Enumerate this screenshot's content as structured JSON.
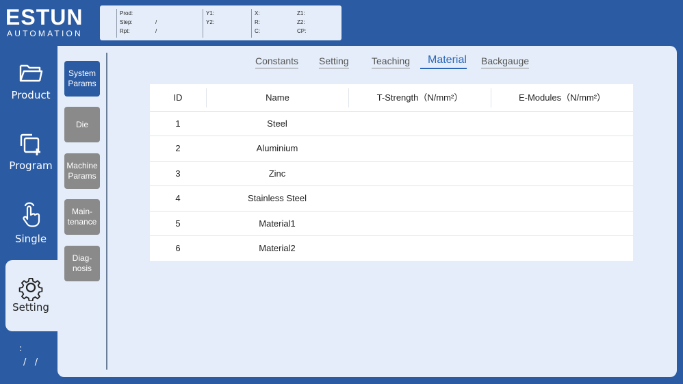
{
  "logo": {
    "brand": "ESTUN",
    "tagline": "AUTOMATION"
  },
  "status": {
    "prod_label": "Prod:",
    "prod_value": "",
    "step_label": "Step:",
    "step_value": "/",
    "rpt_label": "Rpt:",
    "rpt_value": "/",
    "y1_label": "Y1:",
    "y2_label": "Y2:",
    "x_label": "X:",
    "r_label": "R:",
    "c_label": "C:",
    "z1_label": "Z1:",
    "z2_label": "Z2:",
    "cp_label": "CP:"
  },
  "nav": {
    "items": [
      {
        "label": "Product",
        "icon": "folder-icon"
      },
      {
        "label": "Program",
        "icon": "copy-plus-icon"
      },
      {
        "label": "Single",
        "icon": "hand-pointer-icon"
      },
      {
        "label": "Setting",
        "icon": "gear-icon"
      }
    ],
    "footer_line1": ":",
    "footer_line2": "/   /"
  },
  "subnav": {
    "items": [
      {
        "label_1": "System",
        "label_2": "Params"
      },
      {
        "label_1": "Die",
        "label_2": ""
      },
      {
        "label_1": "Machine",
        "label_2": "Params"
      },
      {
        "label_1": "Main-",
        "label_2": "tenance"
      },
      {
        "label_1": "Diag-",
        "label_2": "nosis"
      }
    ]
  },
  "tabs": [
    "Constants",
    "Setting",
    "Teaching",
    "Material",
    "Backgauge"
  ],
  "active_tab": "Material",
  "table": {
    "headers": [
      "ID",
      "Name",
      "T-Strength（N/mm²）",
      "E-Modules（N/mm²）"
    ],
    "rows": [
      {
        "id": "1",
        "name": "Steel",
        "t_strength": "",
        "e_modules": ""
      },
      {
        "id": "2",
        "name": "Aluminium",
        "t_strength": "",
        "e_modules": ""
      },
      {
        "id": "3",
        "name": "Zinc",
        "t_strength": "",
        "e_modules": ""
      },
      {
        "id": "4",
        "name": "Stainless Steel",
        "t_strength": "",
        "e_modules": ""
      },
      {
        "id": "5",
        "name": "Material1",
        "t_strength": "",
        "e_modules": ""
      },
      {
        "id": "6",
        "name": "Material2",
        "t_strength": "",
        "e_modules": ""
      }
    ]
  },
  "colors": {
    "primary": "#2B5BA2",
    "panel": "#E4EDF9",
    "active_tab": "#2B66B8",
    "inactive_button": "#8A8A8A"
  }
}
